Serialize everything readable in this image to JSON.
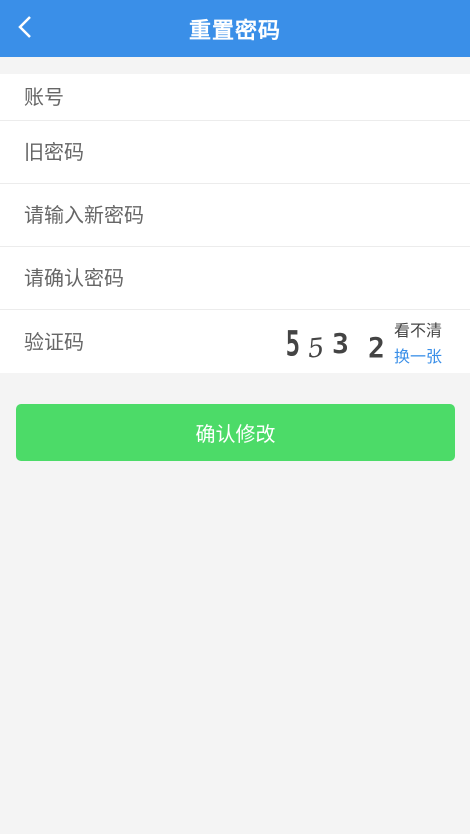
{
  "header": {
    "title": "重置密码"
  },
  "form": {
    "account_placeholder": "账号",
    "old_password_placeholder": "旧密码",
    "new_password_placeholder": "请输入新密码",
    "confirm_password_placeholder": "请确认密码",
    "captcha_placeholder": "验证码",
    "captcha_code": "5532",
    "captcha_unclear_text": "看不清",
    "captcha_refresh_text": "换一张"
  },
  "actions": {
    "submit_label": "确认修改"
  },
  "colors": {
    "header": "#3a8fe8",
    "submit": "#4cdb68",
    "link": "#3a8fe8"
  }
}
